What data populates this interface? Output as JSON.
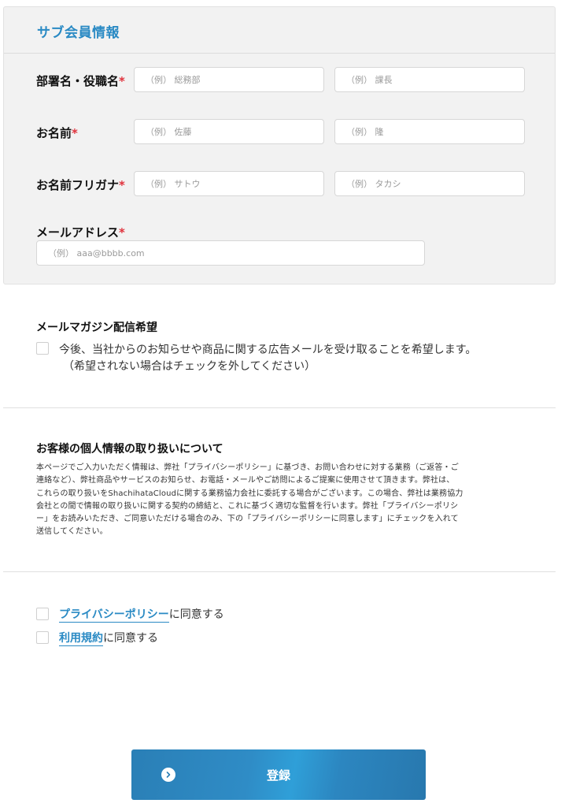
{
  "sub_member": {
    "title": "サブ会員情報",
    "department": {
      "label": "部署名・役職名",
      "required": "*",
      "dept_placeholder": "（例） 総務部",
      "position_placeholder": "（例） 課長"
    },
    "name": {
      "label": "お名前",
      "required": "*",
      "last_placeholder": "（例） 佐藤",
      "first_placeholder": "（例） 隆"
    },
    "kana": {
      "label": "お名前フリガナ",
      "required": "*",
      "last_placeholder": "（例） サトウ",
      "first_placeholder": "（例） タカシ"
    },
    "email": {
      "label": "メールアドレス",
      "required": "*",
      "placeholder": "（例） aaa@bbbb.com"
    }
  },
  "magazine": {
    "title": "メールマガジン配信希望",
    "checkbox_text": "今後、当社からのお知らせや商品に関する広告メールを受け取ることを希望します。",
    "checkbox_note": "（希望されない場合はチェックを外してください）",
    "checked": false
  },
  "privacy": {
    "title": "お客様の個人情報の取り扱いについて",
    "lines": [
      "本ページでご入力いただく情報は、弊社「プライバシーポリシー」に基づき、お問い合わせに対する業務（ご返答・ご",
      "連絡など）、弊社商品やサービスのお知らせ、お電話・メールやご訪問によるご提案に使用させて頂きます。弊社は、",
      "これらの取り扱いをShachihataCloudに関する業務協力会社に委託する場合がございます。この場合、弊社は業務協力",
      "会社との間で情報の取り扱いに関する契約の締結と、これに基づく適切な監督を行います。弊社「プライバシーポリシ",
      "ー」をお読みいただき、ご同意いただける場合のみ、下の「プライバシーポリシーに同意します」にチェックを入れて",
      "送信してください。"
    ]
  },
  "agreements": {
    "privacy_link": "プライバシーポリシー",
    "privacy_suffix": "に同意する",
    "terms_link": "利用規約",
    "terms_suffix": "に同意する"
  },
  "submit": {
    "label": "登録",
    "icon": "chevron-right-circle-icon"
  },
  "colors": {
    "accent": "#2a8ac4",
    "required": "#e0323c",
    "panel_bg": "#f2f2f2"
  }
}
